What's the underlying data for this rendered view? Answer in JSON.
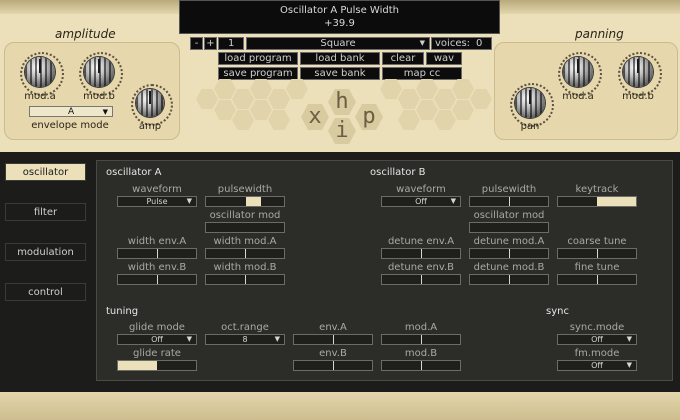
{
  "display": {
    "param_name": "Oscillator A Pulse Width",
    "param_value": "+39.9"
  },
  "amplitude": {
    "title": "amplitude",
    "knobs": [
      "mod.a",
      "mod.b"
    ],
    "envelope_mode_label": "envelope mode",
    "envelope_mode_value": "A",
    "amp_label": "amp"
  },
  "panning": {
    "title": "panning",
    "knobs": [
      "mod.a",
      "mod.b"
    ],
    "pan_label": "pan"
  },
  "program": {
    "minus": "-",
    "plus": "+",
    "number": "1",
    "name": "Square",
    "voices_label": "voices:",
    "voices_value": "0"
  },
  "buttons": {
    "load_program": "load program",
    "load_bank": "load bank",
    "clear": "clear",
    "wav": "wav",
    "save_program": "save program",
    "save_bank": "save bank",
    "map_cc": "map cc"
  },
  "logo": {
    "letters": [
      "x",
      "h",
      "i",
      "p"
    ]
  },
  "tabs": [
    "oscillator",
    "filter",
    "modulation",
    "control"
  ],
  "osc_a": {
    "title": "oscillator A",
    "waveform_label": "waveform",
    "waveform_value": "Pulse",
    "pulsewidth_label": "pulsewidth",
    "pulsewidth_level": 0.699,
    "osc_mod_label": "oscillator mod",
    "width_env_a": "width env.A",
    "width_mod_a": "width mod.A",
    "width_env_b": "width env.B",
    "width_mod_b": "width mod.B"
  },
  "osc_b": {
    "title": "oscillator B",
    "waveform_label": "waveform",
    "waveform_value": "Off",
    "pulsewidth_label": "pulsewidth",
    "keytrack_label": "keytrack",
    "keytrack_level": 1.0,
    "osc_mod_label": "oscillator mod",
    "detune_env_a": "detune env.A",
    "detune_mod_a": "detune mod.A",
    "coarse_tune": "coarse tune",
    "detune_env_b": "detune env.B",
    "detune_mod_b": "detune mod.B",
    "fine_tune": "fine tune"
  },
  "tuning": {
    "title": "tuning",
    "glide_mode_label": "glide mode",
    "glide_mode_value": "Off",
    "oct_range_label": "oct.range",
    "oct_range_value": "8",
    "env_a": "env.A",
    "mod_a": "mod.A",
    "glide_rate_label": "glide rate",
    "glide_rate_level": 0.5,
    "env_b": "env.B",
    "mod_b": "mod.B"
  },
  "sync": {
    "title": "sync",
    "sync_mode_label": "sync.mode",
    "sync_mode_value": "Off",
    "fm_mode_label": "fm.mode",
    "fm_mode_value": "Off"
  },
  "colors": {
    "cream": "#ece0bb",
    "dark_bg": "#1c1c1a",
    "panel_bg": "#2c2c29"
  }
}
